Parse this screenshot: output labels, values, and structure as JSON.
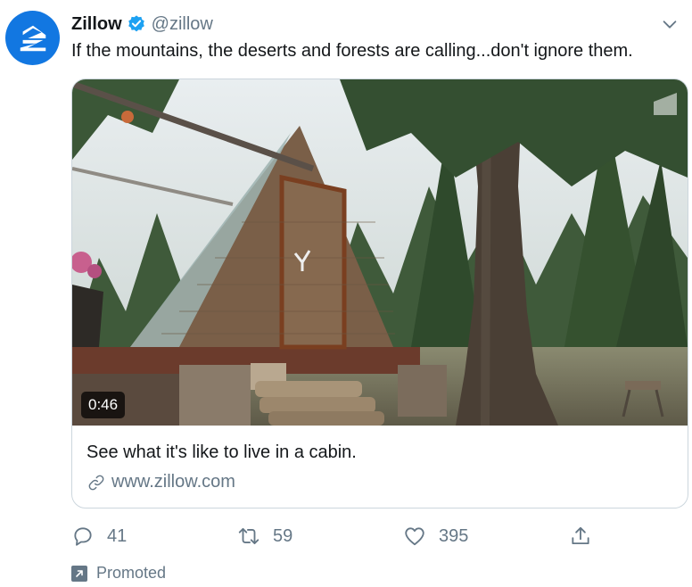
{
  "tweet": {
    "account_name": "Zillow",
    "handle": "@zillow",
    "text": "If the mountains, the deserts and forests are calling...don't ignore them."
  },
  "card": {
    "video_duration": "0:46",
    "title": "See what it's like to live in a cabin.",
    "link": "www.zillow.com"
  },
  "actions": {
    "replies": "41",
    "retweets": "59",
    "likes": "395"
  },
  "promoted_label": "Promoted",
  "colors": {
    "brand": "#1277e1",
    "verified": "#1da1f2",
    "secondary_text": "#657786",
    "border": "#ccd6dd"
  },
  "icons": [
    "zillow-logo",
    "verified-badge-icon",
    "chevron-down-icon",
    "link-icon",
    "reply-icon",
    "retweet-icon",
    "like-icon",
    "share-icon",
    "promoted-icon"
  ]
}
